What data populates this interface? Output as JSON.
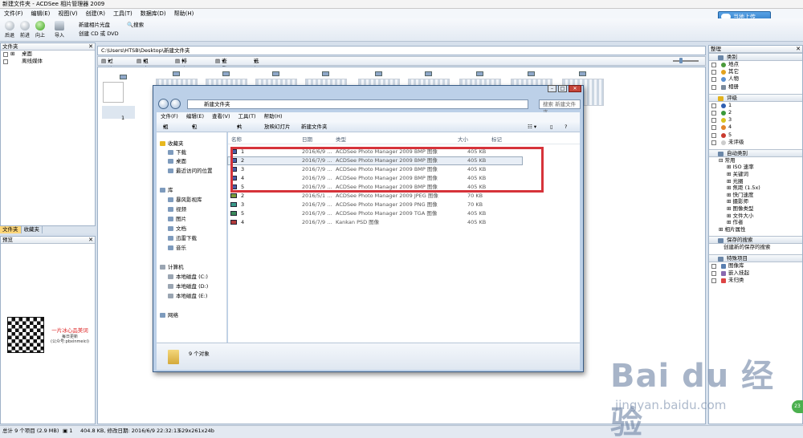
{
  "titlebar": {
    "title": "新建文件夹 - ACDSee 相片管理器 2009"
  },
  "menu": [
    "文件(F)",
    "编辑(E)",
    "视图(V)",
    "创建(R)",
    "工具(T)",
    "数据库(D)",
    "帮助(H)"
  ],
  "upload_label": "当地上传",
  "toolbar": {
    "back": "后退",
    "forward": "前进",
    "up": "向上",
    "import": "导入",
    "new_album_disc": "新建相片光盘",
    "search": "搜索",
    "create_cd": "创建 CD 或 DVD"
  },
  "folders_panel": {
    "title": "文件夹",
    "items": [
      "桌面",
      "离线媒体"
    ]
  },
  "tabs": [
    "文件夹",
    "收藏夹"
  ],
  "preview_panel": {
    "title": "预览",
    "qr_caption": "一片冰心品美词",
    "qr_sub1": "每日更新",
    "qr_sub2": "(公众号:pbxinmeici)"
  },
  "address": {
    "path": "C:\\Users\\HTSB\\Desktop\\新建文件夹"
  },
  "browse_bar": {
    "filter": "过滤方式",
    "group": "组合方式",
    "sort": "排序方式",
    "view": "查看",
    "select": "选择"
  },
  "thumbnail": {
    "page": "1"
  },
  "dialog": {
    "address": "新建文件夹",
    "search_placeholder": "搜索 新建文件夹",
    "menu": [
      "文件(F)",
      "编辑(E)",
      "查看(V)",
      "工具(T)",
      "帮助(H)"
    ],
    "commands": [
      "组织",
      "包含到库中",
      "共享",
      "放映幻灯片",
      "新建文件夹"
    ],
    "nav": {
      "favorites": "收藏夹",
      "favorites_items": [
        "下载",
        "桌面",
        "最近访问的位置"
      ],
      "libraries": "库",
      "library_items": [
        "暴风影视库",
        "视频",
        "图片",
        "文档",
        "迅雷下载",
        "音乐"
      ],
      "computer": "计算机",
      "drives": [
        "本地磁盘 (C:)",
        "本地磁盘 (D:)",
        "本地磁盘 (E:)"
      ],
      "network": "网络"
    },
    "columns": [
      "名称",
      "日期",
      "类型",
      "大小",
      "标记"
    ],
    "files": [
      {
        "name": "1",
        "date": "2016/6/9 ...",
        "type": "ACDSee Photo Manager 2009 BMP 图像",
        "size": "405 KB"
      },
      {
        "name": "2",
        "date": "2016/7/9 ...",
        "type": "ACDSee Photo Manager 2009 BMP 图像",
        "size": "405 KB"
      },
      {
        "name": "3",
        "date": "2016/7/9 ...",
        "type": "ACDSee Photo Manager 2009 BMP 图像",
        "size": "405 KB"
      },
      {
        "name": "4",
        "date": "2016/7/9 ...",
        "type": "ACDSee Photo Manager 2009 BMP 图像",
        "size": "405 KB"
      },
      {
        "name": "5",
        "date": "2016/7/9 ...",
        "type": "ACDSee Photo Manager 2009 BMP 图像",
        "size": "405 KB"
      },
      {
        "name": "2",
        "date": "2016/5/1 ...",
        "type": "ACDSee Photo Manager 2009 JPEG 图像",
        "size": "70 KB"
      },
      {
        "name": "3",
        "date": "2016/7/9 ...",
        "type": "ACDSee Photo Manager 2009 PNG 图像",
        "size": "70 KB"
      },
      {
        "name": "5",
        "date": "2016/7/9 ...",
        "type": "ACDSee Photo Manager 2009 TGA 图像",
        "size": "405 KB"
      },
      {
        "name": "4",
        "date": "2016/7/9 ...",
        "type": "Kankan PSD 图像",
        "size": "405 KB"
      }
    ],
    "details": "9 个对象"
  },
  "organize": {
    "title": "整理",
    "categories": {
      "title": "类别",
      "items": [
        "地点",
        "其它",
        "人物",
        "相册"
      ]
    },
    "ratings": {
      "title": "评级",
      "items": [
        "1",
        "2",
        "3",
        "4",
        "5",
        "未评级"
      ]
    },
    "auto_categories": {
      "title": "自动类别",
      "items": [
        "常用",
        "ISO 速率",
        "关键词",
        "光圈",
        "焦距 (1.5x)",
        "快门速度",
        "摄影师",
        "图像类型",
        "文件大小",
        "作者",
        "相片属性"
      ]
    },
    "saved_searches": {
      "title": "保存的搜索",
      "items": [
        "创建新的保存的搜索"
      ]
    },
    "special": {
      "title": "特殊项目",
      "items": [
        "图像库",
        "嵌入挂起",
        "未归类"
      ]
    }
  },
  "statusbar": {
    "text": "总计 9 个项目 (2.9 MB)",
    "sel": "1",
    "info": "404.8 KB, 修改日期: 2016/6/9 22:32:13",
    "dims": "529x261x24b"
  },
  "watermark": {
    "main": "Bai du 经验",
    "sub": "jingyan.baidu.com"
  },
  "badge": "23"
}
